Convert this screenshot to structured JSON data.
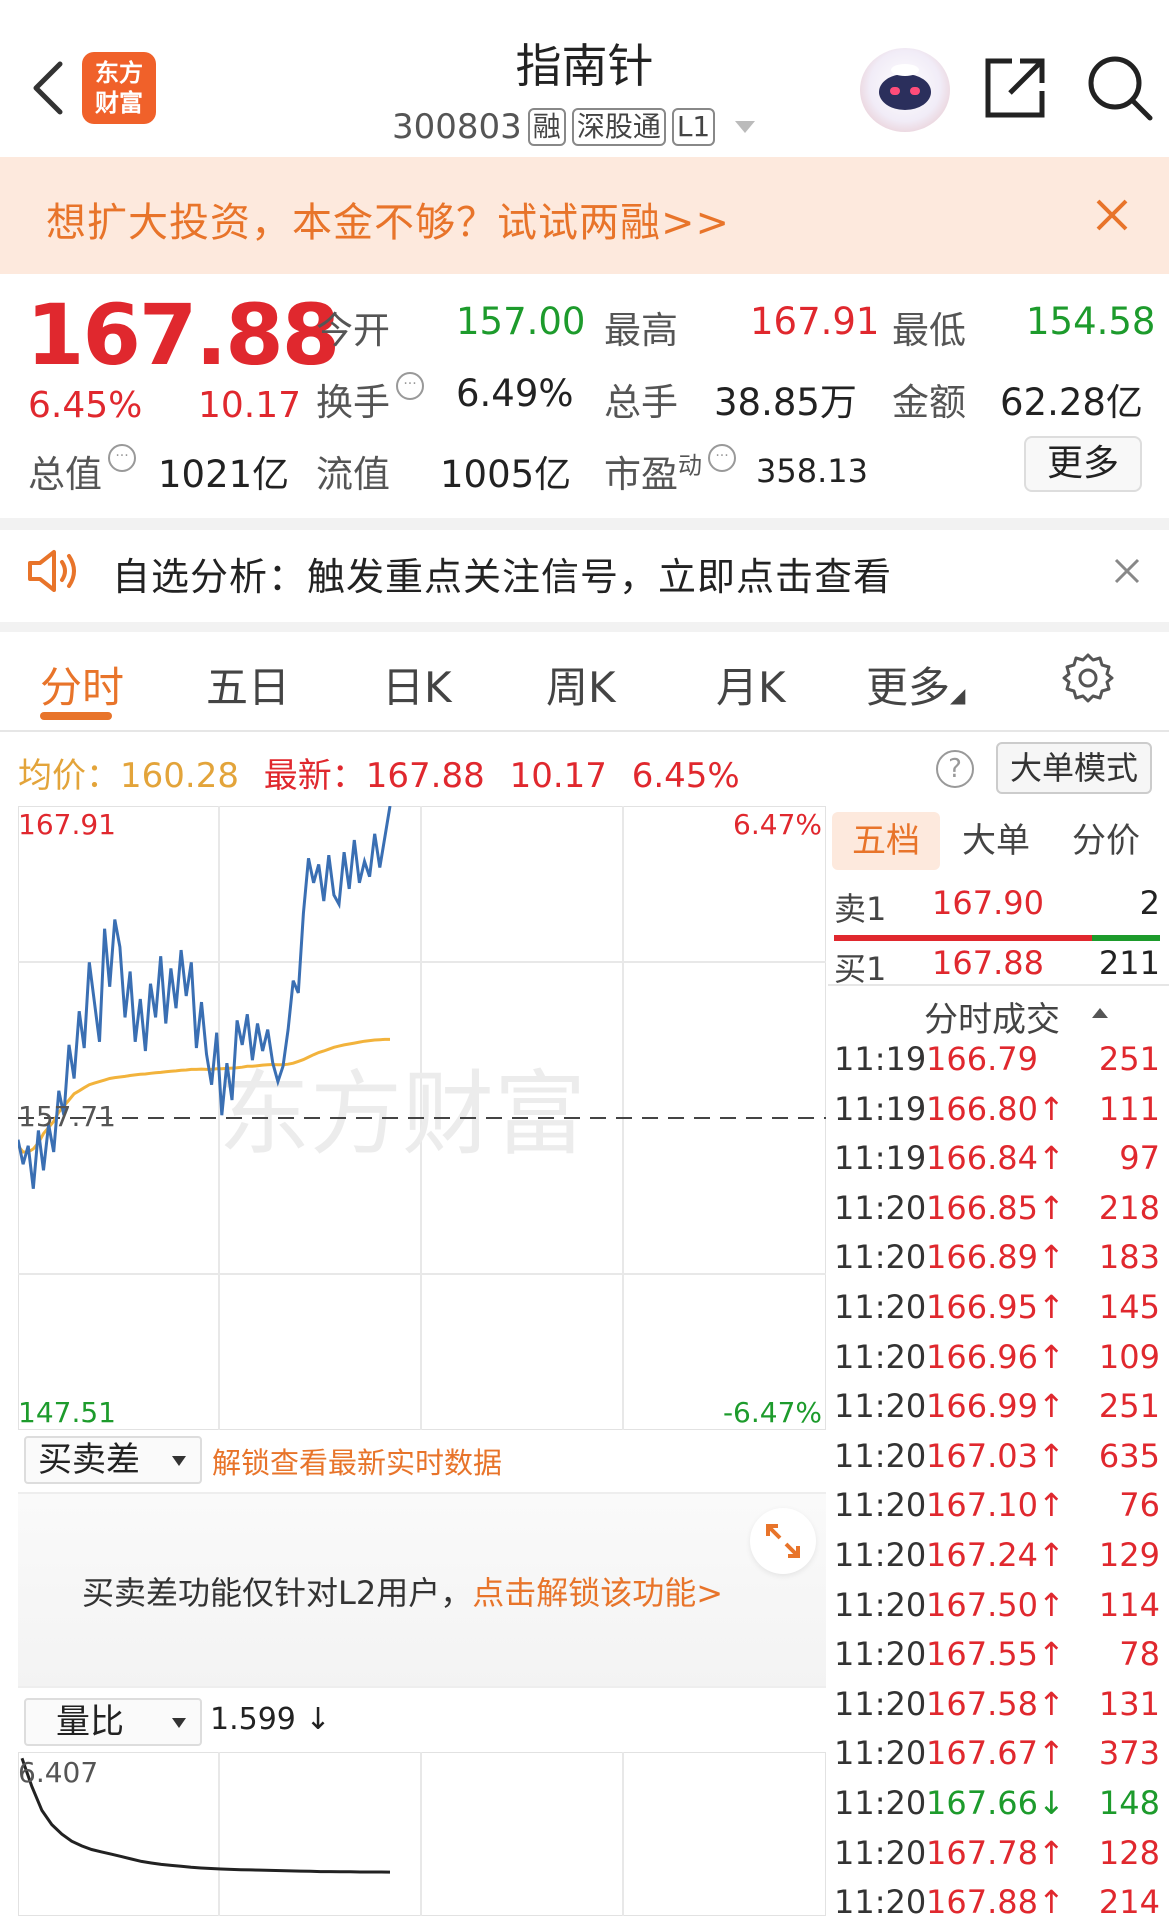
{
  "header": {
    "logo_line1": "东方",
    "logo_line2": "财富",
    "title": "指南针",
    "code": "300803",
    "tags": [
      "融",
      "深股通",
      "L1"
    ]
  },
  "promo": {
    "text": "想扩大投资，本金不够？试试两融>>"
  },
  "quote": {
    "price": "167.88",
    "change_pct": "6.45%",
    "change_amt": "10.17",
    "open_label": "今开",
    "open": "157.00",
    "high_label": "最高",
    "high": "167.91",
    "low_label": "最低",
    "low": "154.58",
    "turnover_label": "换手",
    "turnover": "6.49%",
    "volume_label": "总手",
    "volume": "38.85万",
    "amount_label": "金额",
    "amount": "62.28亿",
    "mktcap_label": "总值",
    "mktcap": "1021亿",
    "float_label": "流值",
    "float": "1005亿",
    "pe_label": "市盈",
    "pe_sup": "动",
    "pe": "358.13",
    "more_label": "更多"
  },
  "alert": {
    "text": "自选分析：触发重点关注信号，立即点击查看"
  },
  "tabs": [
    "分时",
    "五日",
    "日K",
    "周K",
    "月K",
    "更多"
  ],
  "info": {
    "avg_label": "均价：",
    "avg": "160.28",
    "latest_label": "最新：",
    "latest": "167.88",
    "latest_chg": "10.17",
    "latest_pct": "6.45%",
    "help": "?",
    "big_order_label": "大单模式"
  },
  "chart_data": {
    "type": "line",
    "title": "",
    "ylim": [
      147.51,
      167.91
    ],
    "y_top_label": "167.91",
    "y_mid_label": "157.71",
    "y_bottom_label": "147.51",
    "pct_top_label": "6.47%",
    "pct_bottom_label": "-6.47%",
    "prev_close": 157.71,
    "watermark": "东方财富",
    "series": [
      {
        "values": [
          157.0,
          156.2,
          156.8,
          155.4,
          157.3,
          156.0,
          157.5,
          156.6,
          158.6,
          157.8,
          160.1,
          159.0,
          161.2,
          160.0,
          162.8,
          161.5,
          160.2,
          163.9,
          162.0,
          164.2,
          163.3,
          161.0,
          162.5,
          160.2,
          161.6,
          159.9,
          162.1,
          161.0,
          163.0,
          160.8,
          162.6,
          161.3,
          163.2,
          161.7,
          162.8,
          160.0,
          161.5,
          159.8,
          158.8,
          160.5,
          157.8,
          159.5,
          158.3,
          160.9,
          160.1,
          161.1,
          159.6,
          160.8,
          159.9,
          160.6,
          159.5,
          158.9,
          159.4,
          160.6,
          162.2,
          161.8,
          164.4,
          166.2,
          165.4,
          166.0,
          164.8,
          166.3,
          165.0,
          164.7,
          166.4,
          165.2,
          166.8,
          165.4,
          166.1,
          165.6,
          167.0,
          165.9,
          166.9,
          167.91
        ]
      },
      {
        "values": [
          156.8,
          156.6,
          156.6,
          156.7,
          156.9,
          157.2,
          157.4,
          157.6,
          157.9,
          158.1,
          158.3,
          158.5,
          158.6,
          158.7,
          158.8,
          158.85,
          158.9,
          158.95,
          159.0,
          159.03,
          159.05,
          159.07,
          159.1,
          159.12,
          159.14,
          159.15,
          159.17,
          159.19,
          159.2,
          159.22,
          159.24,
          159.25,
          159.27,
          159.28,
          159.3,
          159.3,
          159.31,
          159.3,
          159.3,
          159.32,
          159.32,
          159.33,
          159.34,
          159.35,
          159.37,
          159.4,
          159.4,
          159.42,
          159.44,
          159.45,
          159.46,
          159.45,
          159.45,
          159.47,
          159.5,
          159.56,
          159.62,
          159.7,
          159.78,
          159.85,
          159.9,
          159.96,
          160.02,
          160.06,
          160.1,
          160.13,
          160.16,
          160.19,
          160.22,
          160.24,
          160.26,
          160.27,
          160.28,
          160.28
        ]
      }
    ]
  },
  "orderbook": {
    "tabs": [
      "五档",
      "大单",
      "分价"
    ],
    "sell1_label": "卖1",
    "sell1_price": "167.90",
    "sell1_vol": "2",
    "buy1_label": "买1",
    "buy1_price": "167.88",
    "buy1_vol": "211",
    "ticks_header": "分时成交",
    "ticks": [
      {
        "t": "11:19",
        "p": "166.79",
        "v": "251"
      },
      {
        "t": "11:19",
        "p": "166.80↑",
        "v": "111"
      },
      {
        "t": "11:19",
        "p": "166.84↑",
        "v": "97"
      },
      {
        "t": "11:20",
        "p": "166.85↑",
        "v": "218"
      },
      {
        "t": "11:20",
        "p": "166.89↑",
        "v": "183"
      },
      {
        "t": "11:20",
        "p": "166.95↑",
        "v": "145"
      },
      {
        "t": "11:20",
        "p": "166.96↑",
        "v": "109"
      },
      {
        "t": "11:20",
        "p": "166.99↑",
        "v": "251"
      },
      {
        "t": "11:20",
        "p": "167.03↑",
        "v": "635"
      },
      {
        "t": "11:20",
        "p": "167.10↑",
        "v": "76"
      },
      {
        "t": "11:20",
        "p": "167.24↑",
        "v": "129"
      },
      {
        "t": "11:20",
        "p": "167.50↑",
        "v": "114"
      },
      {
        "t": "11:20",
        "p": "167.55↑",
        "v": "78"
      },
      {
        "t": "11:20",
        "p": "167.58↑",
        "v": "131"
      },
      {
        "t": "11:20",
        "p": "167.67↑",
        "v": "373"
      },
      {
        "t": "11:20",
        "p": "167.66↓",
        "v": "148"
      },
      {
        "t": "11:20",
        "p": "167.78↑",
        "v": "128"
      },
      {
        "t": "11:20",
        "p": "167.88↑",
        "v": "214"
      }
    ]
  },
  "bidask": {
    "select_label": "买卖差",
    "unlock_text": "解锁查看最新实时数据",
    "msg": "买卖差功能仅针对L2用户，",
    "msg_link": "点击解锁该功能>"
  },
  "volratio": {
    "select_label": "量比",
    "value": "1.599 ↓",
    "max_label": "6.407",
    "values": [
      6.4,
      5.2,
      4.2,
      3.6,
      3.2,
      2.9,
      2.7,
      2.55,
      2.45,
      2.35,
      2.25,
      2.15,
      2.05,
      1.98,
      1.92,
      1.88,
      1.84,
      1.8,
      1.77,
      1.75,
      1.73,
      1.71,
      1.7,
      1.69,
      1.68,
      1.67,
      1.66,
      1.65,
      1.64,
      1.63,
      1.62,
      1.62,
      1.61,
      1.61,
      1.6,
      1.6,
      1.6,
      1.599
    ]
  }
}
